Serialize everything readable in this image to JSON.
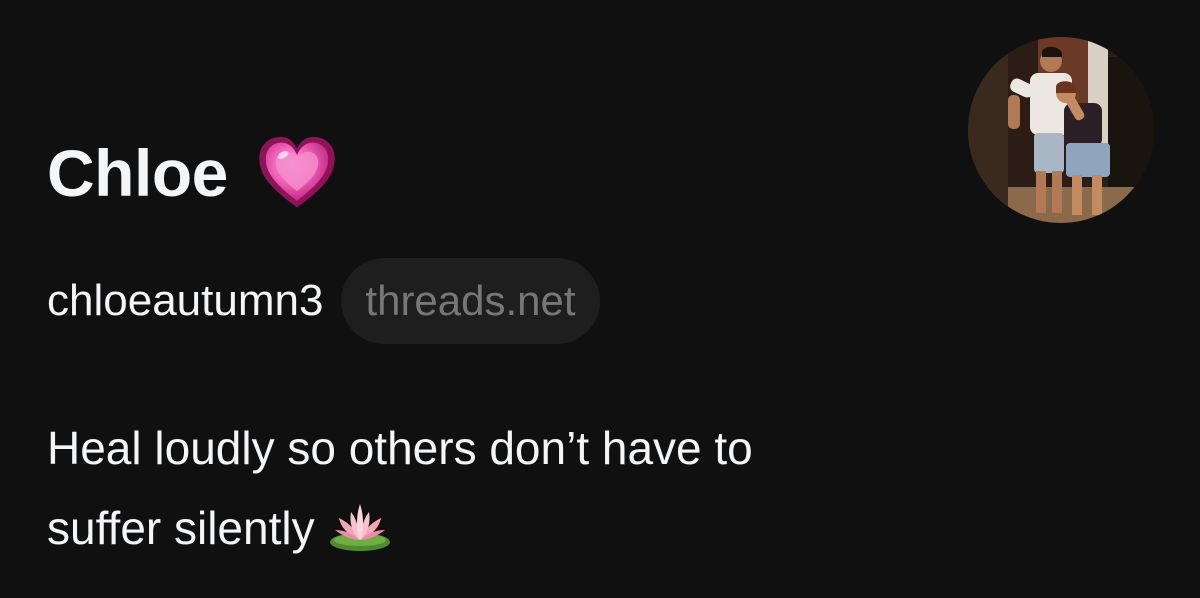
{
  "profile": {
    "display_name": "Chloe",
    "name_emoji": "pink-heart-icon",
    "username": "chloeautumn3",
    "domain_badge": "threads.net",
    "bio_line_1": "Heal loudly so others don’t have to",
    "bio_line_2": "suffer silently",
    "bio_emoji": "lotus-icon",
    "avatar": "profile-photo-avatar"
  },
  "colors": {
    "background": "#101010",
    "primary_text": "#f3f5f7",
    "secondary_text": "#777777",
    "pill_background": "#1e1e1e",
    "heart": "#e0429a"
  }
}
